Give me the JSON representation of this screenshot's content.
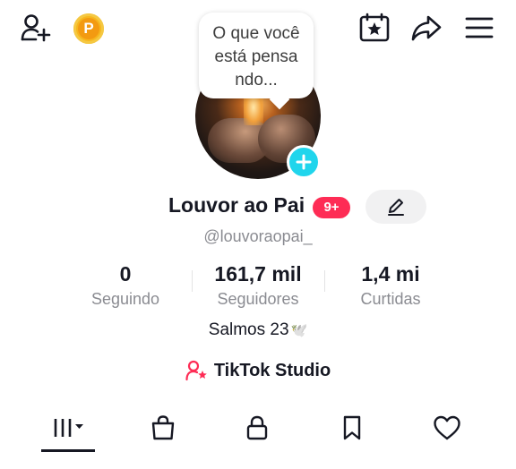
{
  "topbar": {
    "add_user_icon": "person-plus-icon",
    "coin_letter": "P",
    "coin_color": "#f7b61d",
    "calendar_icon": "calendar-star-icon",
    "share_icon": "share-arrow-icon",
    "menu_icon": "hamburger-menu-icon"
  },
  "bubble": {
    "line1": "O que você",
    "line2": "está pensa",
    "line3": "ndo..."
  },
  "profile": {
    "name": "Louvor ao Pai",
    "notification_badge": "9+",
    "badge_color": "#fe2c55",
    "handle": "@louvoraopai_",
    "avatar_add_color": "#20d5ec"
  },
  "stats": {
    "following_value": "0",
    "following_label": "Seguindo",
    "followers_value": "161,7 mil",
    "followers_label": "Seguidores",
    "likes_value": "1,4 mi",
    "likes_label": "Curtidas"
  },
  "bio": {
    "text": "Salmos 23",
    "emoji": "🕊️"
  },
  "studio": {
    "label": "TikTok Studio",
    "icon": "person-star-icon",
    "icon_color": "#fe2c55"
  },
  "tabs": [
    {
      "name": "videos",
      "icon": "grid-bars-icon",
      "active": true
    },
    {
      "name": "shop",
      "icon": "shopping-bag-icon"
    },
    {
      "name": "private",
      "icon": "lock-icon"
    },
    {
      "name": "saved",
      "icon": "bookmark-icon"
    },
    {
      "name": "liked",
      "icon": "heart-icon"
    }
  ]
}
